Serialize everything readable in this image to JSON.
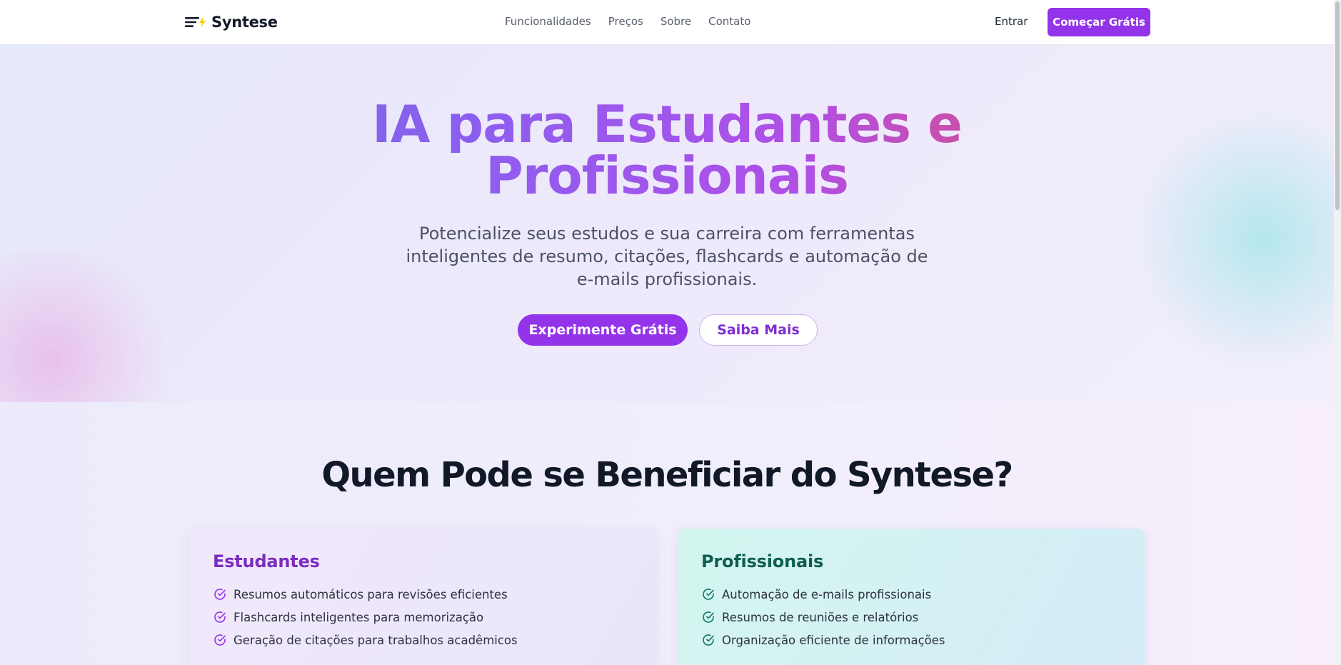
{
  "header": {
    "logo_text": "Syntese",
    "nav": [
      "Funcionalidades",
      "Preços",
      "Sobre",
      "Contato"
    ],
    "login_label": "Entrar",
    "cta_label": "Começar Grátis"
  },
  "hero": {
    "title_line1": "IA para Estudantes e",
    "title_line2": "Profissionais",
    "subtitle": "Potencialize seus estudos e sua carreira com ferramentas inteligentes de resumo, citações, flashcards e automação de e-mails profissionais.",
    "primary_button": "Experimente Grátis",
    "secondary_button": "Saiba Mais"
  },
  "benefits": {
    "title": "Quem Pode se Beneficiar do Syntese?",
    "cards": [
      {
        "title": "Estudantes",
        "items": [
          "Resumos automáticos para revisões eficientes",
          "Flashcards inteligentes para memorização",
          "Geração de citações para trabalhos acadêmicos"
        ]
      },
      {
        "title": "Profissionais",
        "items": [
          "Automação de e-mails profissionais",
          "Resumos de reuniões e relatórios",
          "Organização eficiente de informações"
        ]
      }
    ]
  },
  "colors": {
    "accent": "#9333ea",
    "students_heading": "#7b2cbf",
    "professionals_heading": "#0f5e4e"
  }
}
